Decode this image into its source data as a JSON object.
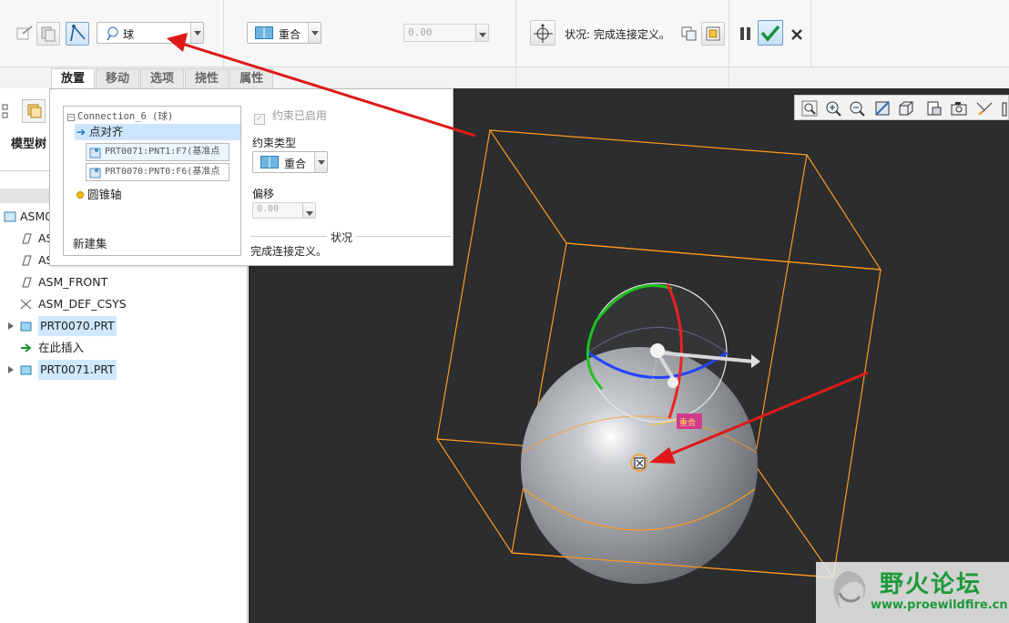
{
  "ribbon": {
    "type_value": "球",
    "constraint_value": "重合",
    "offset_value": "0.00",
    "status_text": "状况: 完成连接定义。"
  },
  "tabs": [
    "放置",
    "移动",
    "选项",
    "挠性",
    "属性"
  ],
  "left_panel": {
    "model_tree_label": "模型树",
    "tree_items": [
      "ASM0",
      "AS",
      "AS",
      "ASM_FRONT",
      "ASM_DEF_CSYS",
      "PRT0070.PRT",
      "在此插入",
      "PRT0071.PRT"
    ]
  },
  "placement": {
    "connection_label": "Connection_6 (球)",
    "point_align_label": "点对齐",
    "ref1": "PRT0071:PNT1:F7(基准点",
    "ref2": "PRT0070:PNT0:F6(基准点",
    "cone_axis_label": "圆锥轴",
    "new_set_label": "新建集",
    "constraint_enabled_label": "约束已启用",
    "constraint_type_label": "约束类型",
    "constraint_type_value": "重合",
    "offset_label": "偏移",
    "offset_value": "0.00",
    "status_heading": "状况",
    "status_text": "完成连接定义。"
  },
  "canvas": {
    "coincident_tag": "重合"
  },
  "watermark": {
    "title": "野火论坛",
    "url": "www.proewildfire.cn"
  }
}
